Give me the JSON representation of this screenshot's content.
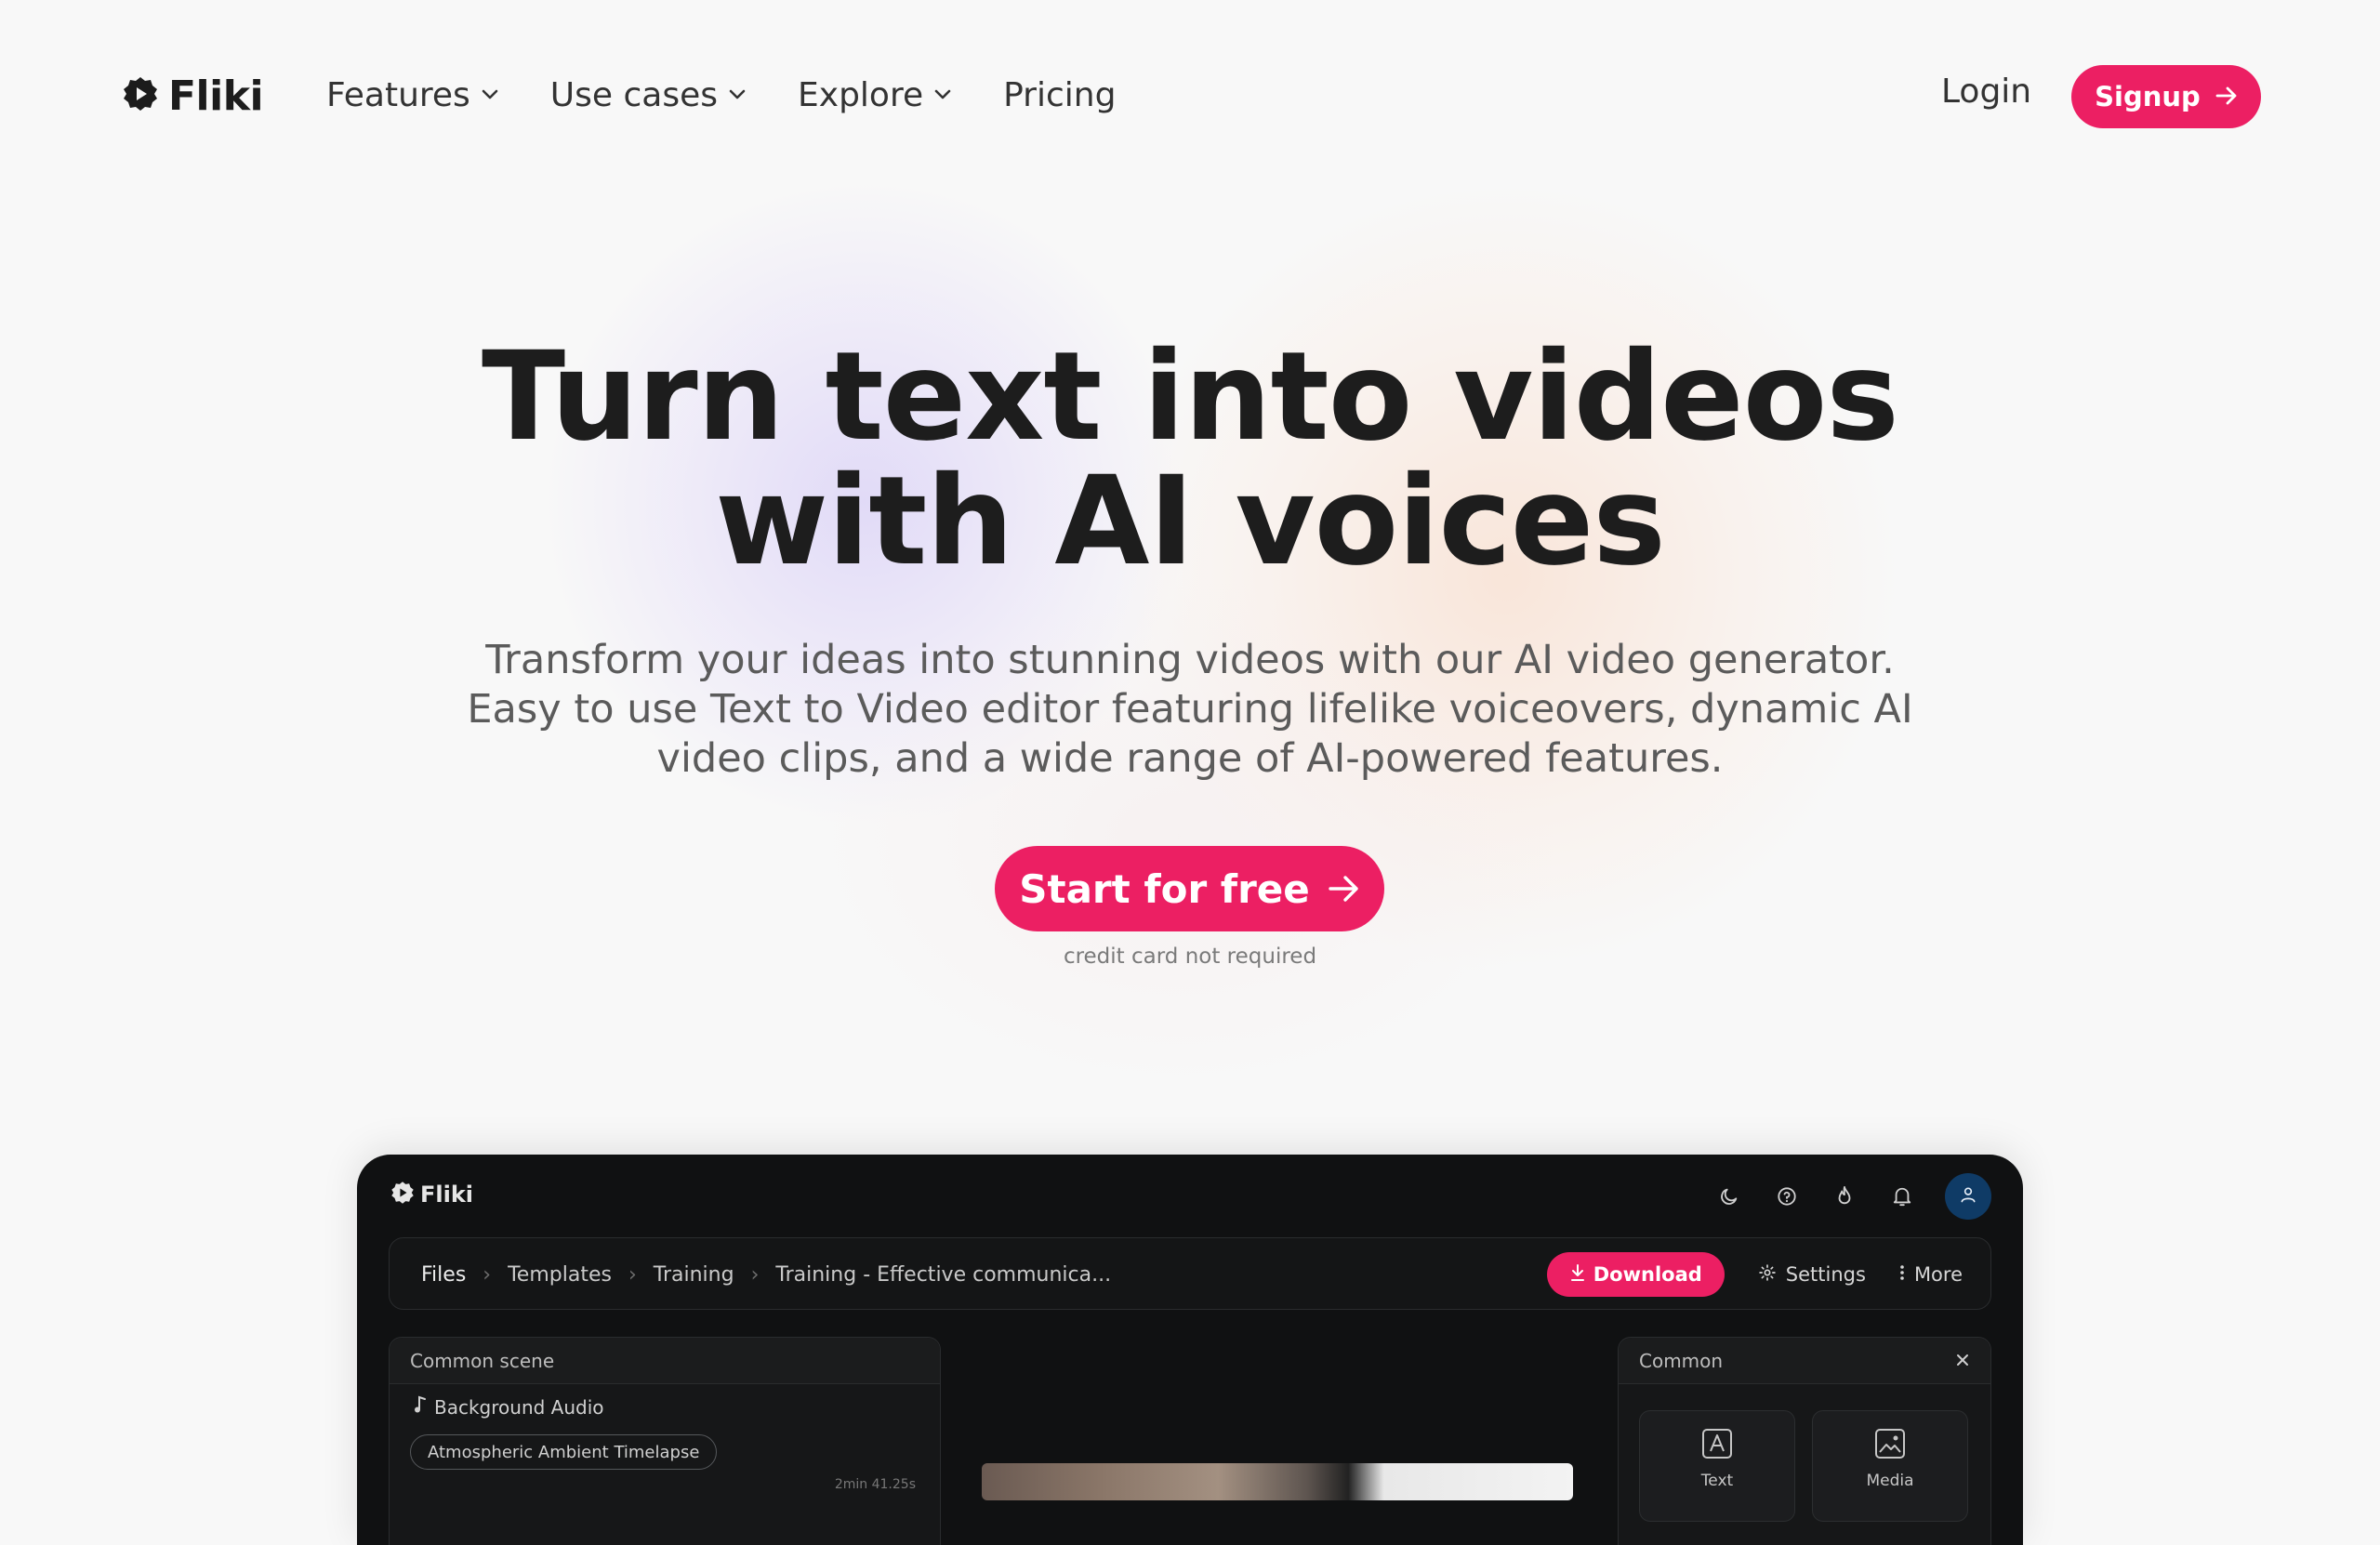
{
  "brand": {
    "name": "Fliki",
    "accent": "#ec1f63"
  },
  "nav": {
    "items": [
      {
        "label": "Features",
        "has_menu": true
      },
      {
        "label": "Use cases",
        "has_menu": true
      },
      {
        "label": "Explore",
        "has_menu": true
      },
      {
        "label": "Pricing",
        "has_menu": false
      }
    ],
    "login_label": "Login",
    "signup_label": "Signup"
  },
  "hero": {
    "title_line1": "Turn text into videos",
    "title_line2": "with AI voices",
    "subtitle_line1": "Transform your ideas into stunning videos with our AI video generator.",
    "subtitle_line2": "Easy to use Text to Video editor featuring lifelike voiceovers, dynamic AI",
    "subtitle_line3": "video clips, and a wide range of AI-powered features.",
    "cta_label": "Start for free",
    "cta_note": "credit card not required"
  },
  "app": {
    "logo": "Fliki",
    "header_icons": [
      "moon-icon",
      "help-icon",
      "fire-icon",
      "bell-icon",
      "user-icon"
    ],
    "breadcrumb": [
      "Files",
      "Templates",
      "Training",
      "Training - Effective communica..."
    ],
    "actions": {
      "download": "Download",
      "settings": "Settings",
      "more": "More"
    },
    "left_panel": {
      "title": "Common scene",
      "audio_label": "Background Audio",
      "track": "Atmospheric Ambient Timelapse",
      "duration": "2min 41.25s"
    },
    "right_panel": {
      "title": "Common",
      "tiles": [
        "Text",
        "Media"
      ]
    }
  }
}
